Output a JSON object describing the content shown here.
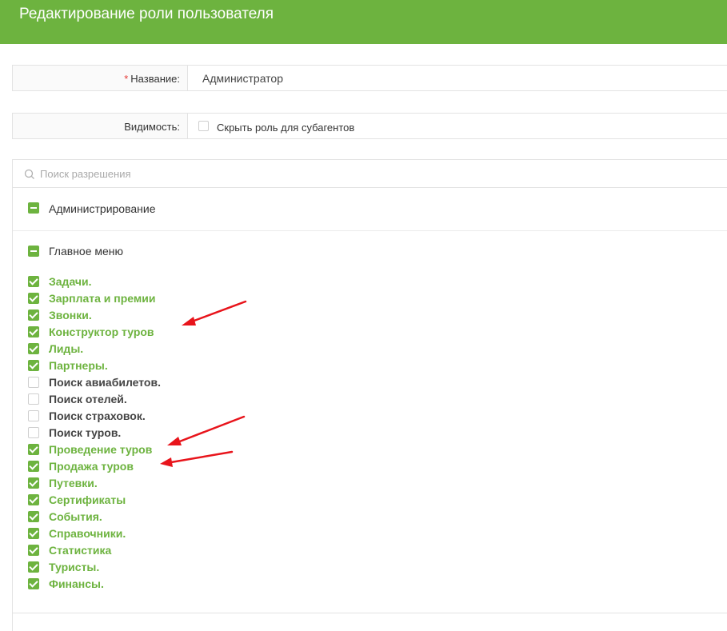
{
  "header": {
    "title": "Редактирование роли пользователя",
    "color": "#6db33f"
  },
  "name_row": {
    "required_mark": "*",
    "label": "Название:",
    "value": "Администратор"
  },
  "visibility_row": {
    "label": "Видимость:",
    "checkbox_label": "Скрыть роль для субагентов",
    "checked": false
  },
  "search": {
    "placeholder": "Поиск разрешения"
  },
  "groups": [
    {
      "label": "Администрирование",
      "state": "partial"
    },
    {
      "label": "Главное меню",
      "state": "partial"
    }
  ],
  "permissions": [
    {
      "label": "Задачи.",
      "checked": true
    },
    {
      "label": "Зарплата и премии",
      "checked": true
    },
    {
      "label": "Звонки.",
      "checked": true
    },
    {
      "label": "Конструктор туров",
      "checked": true
    },
    {
      "label": "Лиды.",
      "checked": true
    },
    {
      "label": "Партнеры.",
      "checked": true
    },
    {
      "label": "Поиск авиабилетов.",
      "checked": false
    },
    {
      "label": "Поиск отелей.",
      "checked": false
    },
    {
      "label": "Поиск страховок.",
      "checked": false
    },
    {
      "label": "Поиск туров.",
      "checked": false
    },
    {
      "label": "Проведение туров",
      "checked": true
    },
    {
      "label": "Продажа туров",
      "checked": true
    },
    {
      "label": "Путевки.",
      "checked": true
    },
    {
      "label": "Сертификаты",
      "checked": true
    },
    {
      "label": "События.",
      "checked": true
    },
    {
      "label": "Справочники.",
      "checked": true
    },
    {
      "label": "Статистика",
      "checked": true
    },
    {
      "label": "Туристы.",
      "checked": true
    },
    {
      "label": "Финансы.",
      "checked": true
    }
  ],
  "annotation_color": "#e8141b"
}
